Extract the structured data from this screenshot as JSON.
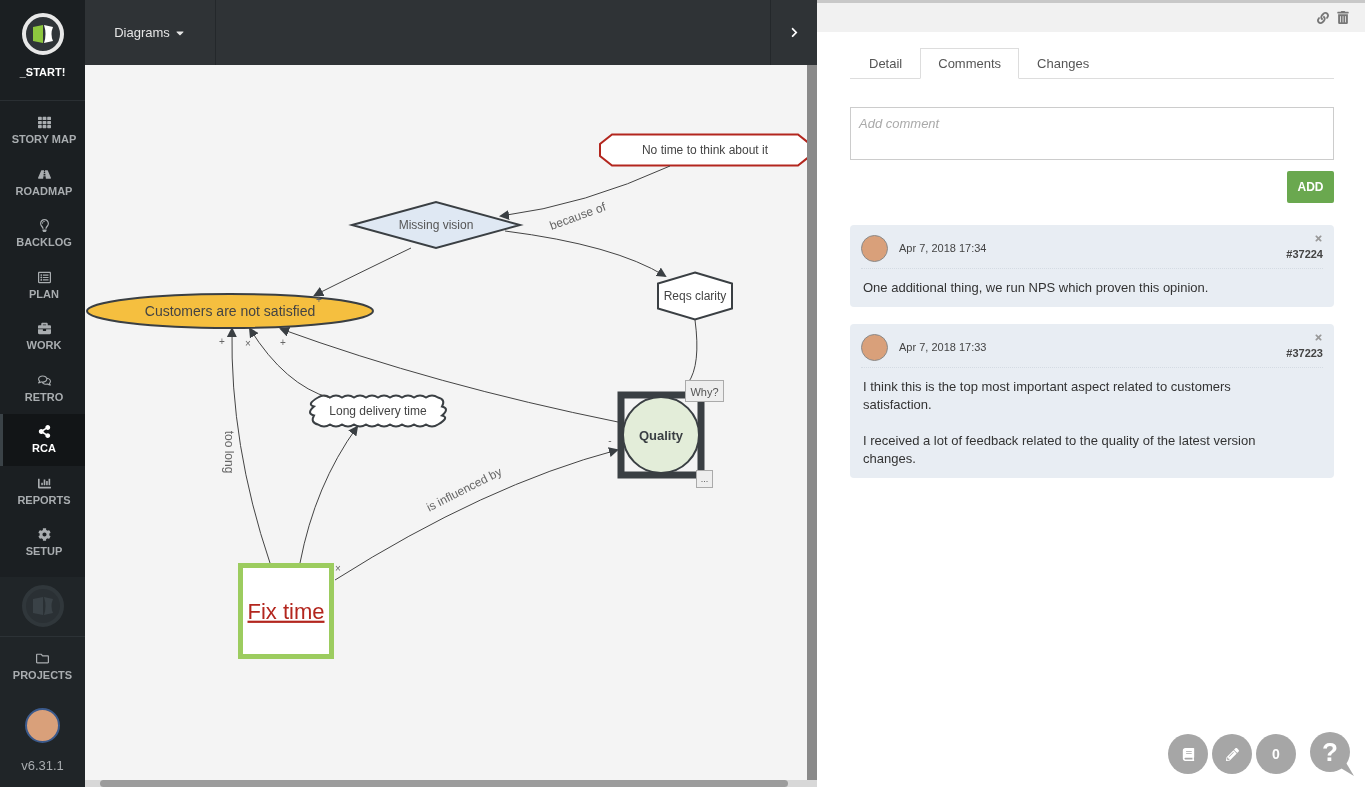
{
  "sidebar": {
    "logo_label": "_START!",
    "items": [
      {
        "label": "STORY MAP",
        "selected": false
      },
      {
        "label": "ROADMAP",
        "selected": false
      },
      {
        "label": "BACKLOG",
        "selected": false
      },
      {
        "label": "PLAN",
        "selected": false
      },
      {
        "label": "WORK",
        "selected": false
      },
      {
        "label": "RETRO",
        "selected": false
      },
      {
        "label": "RCA",
        "selected": true
      },
      {
        "label": "REPORTS",
        "selected": false
      },
      {
        "label": "SETUP",
        "selected": false
      }
    ],
    "projects_label": "PROJECTS",
    "version": "v6.31.1"
  },
  "toolbar": {
    "menu_label": "Diagrams"
  },
  "diagram": {
    "nodes": [
      {
        "kind": "octagon",
        "text": "No time to think about it"
      },
      {
        "kind": "diamond",
        "text": "Missing vision"
      },
      {
        "kind": "ellipse",
        "text": "Customers are not satisfied"
      },
      {
        "kind": "hexagon",
        "text": "Reqs clarity"
      },
      {
        "kind": "cloud",
        "text": "Long delivery time"
      },
      {
        "kind": "circle",
        "text": "Quality",
        "top_button": "Why?",
        "bottom_button": "..."
      },
      {
        "kind": "square",
        "text": "Fix time"
      }
    ],
    "edges": [
      {
        "label": "because of",
        "arrow": true
      },
      {
        "arrow": true
      },
      {
        "arrow": true,
        "end_sign": "+"
      },
      {
        "label": "too long",
        "arrow": true,
        "end_sign": "+"
      },
      {
        "arrow": true
      },
      {
        "arrow": true,
        "end_sign": "×"
      },
      {
        "arrow": true,
        "end_sign": "+"
      },
      {
        "label": "is influenced by",
        "arrow": true,
        "start_sign": "×",
        "end_sign": "-"
      },
      {
        "arrow": false
      }
    ]
  },
  "detail": {
    "tabs": [
      {
        "label": "Detail",
        "selected": false
      },
      {
        "label": "Comments",
        "selected": true
      },
      {
        "label": "Changes",
        "selected": false
      }
    ],
    "comment_field": {
      "placeholder": "Add comment"
    },
    "add_button": "ADD",
    "comments": [
      {
        "date": "Apr 7, 2018 17:34",
        "number": "#37224",
        "paragraphs": [
          "One additional thing, we run NPS which proven this opinion."
        ]
      },
      {
        "date": "Apr 7, 2018 17:33",
        "number": "#37223",
        "paragraphs": [
          "I think this is the top most important aspect related to customers satisfaction.",
          "I received a lot of feedback related to the quality of the latest version changes."
        ]
      }
    ]
  },
  "floating": {
    "count": "0",
    "help_label": "?"
  }
}
